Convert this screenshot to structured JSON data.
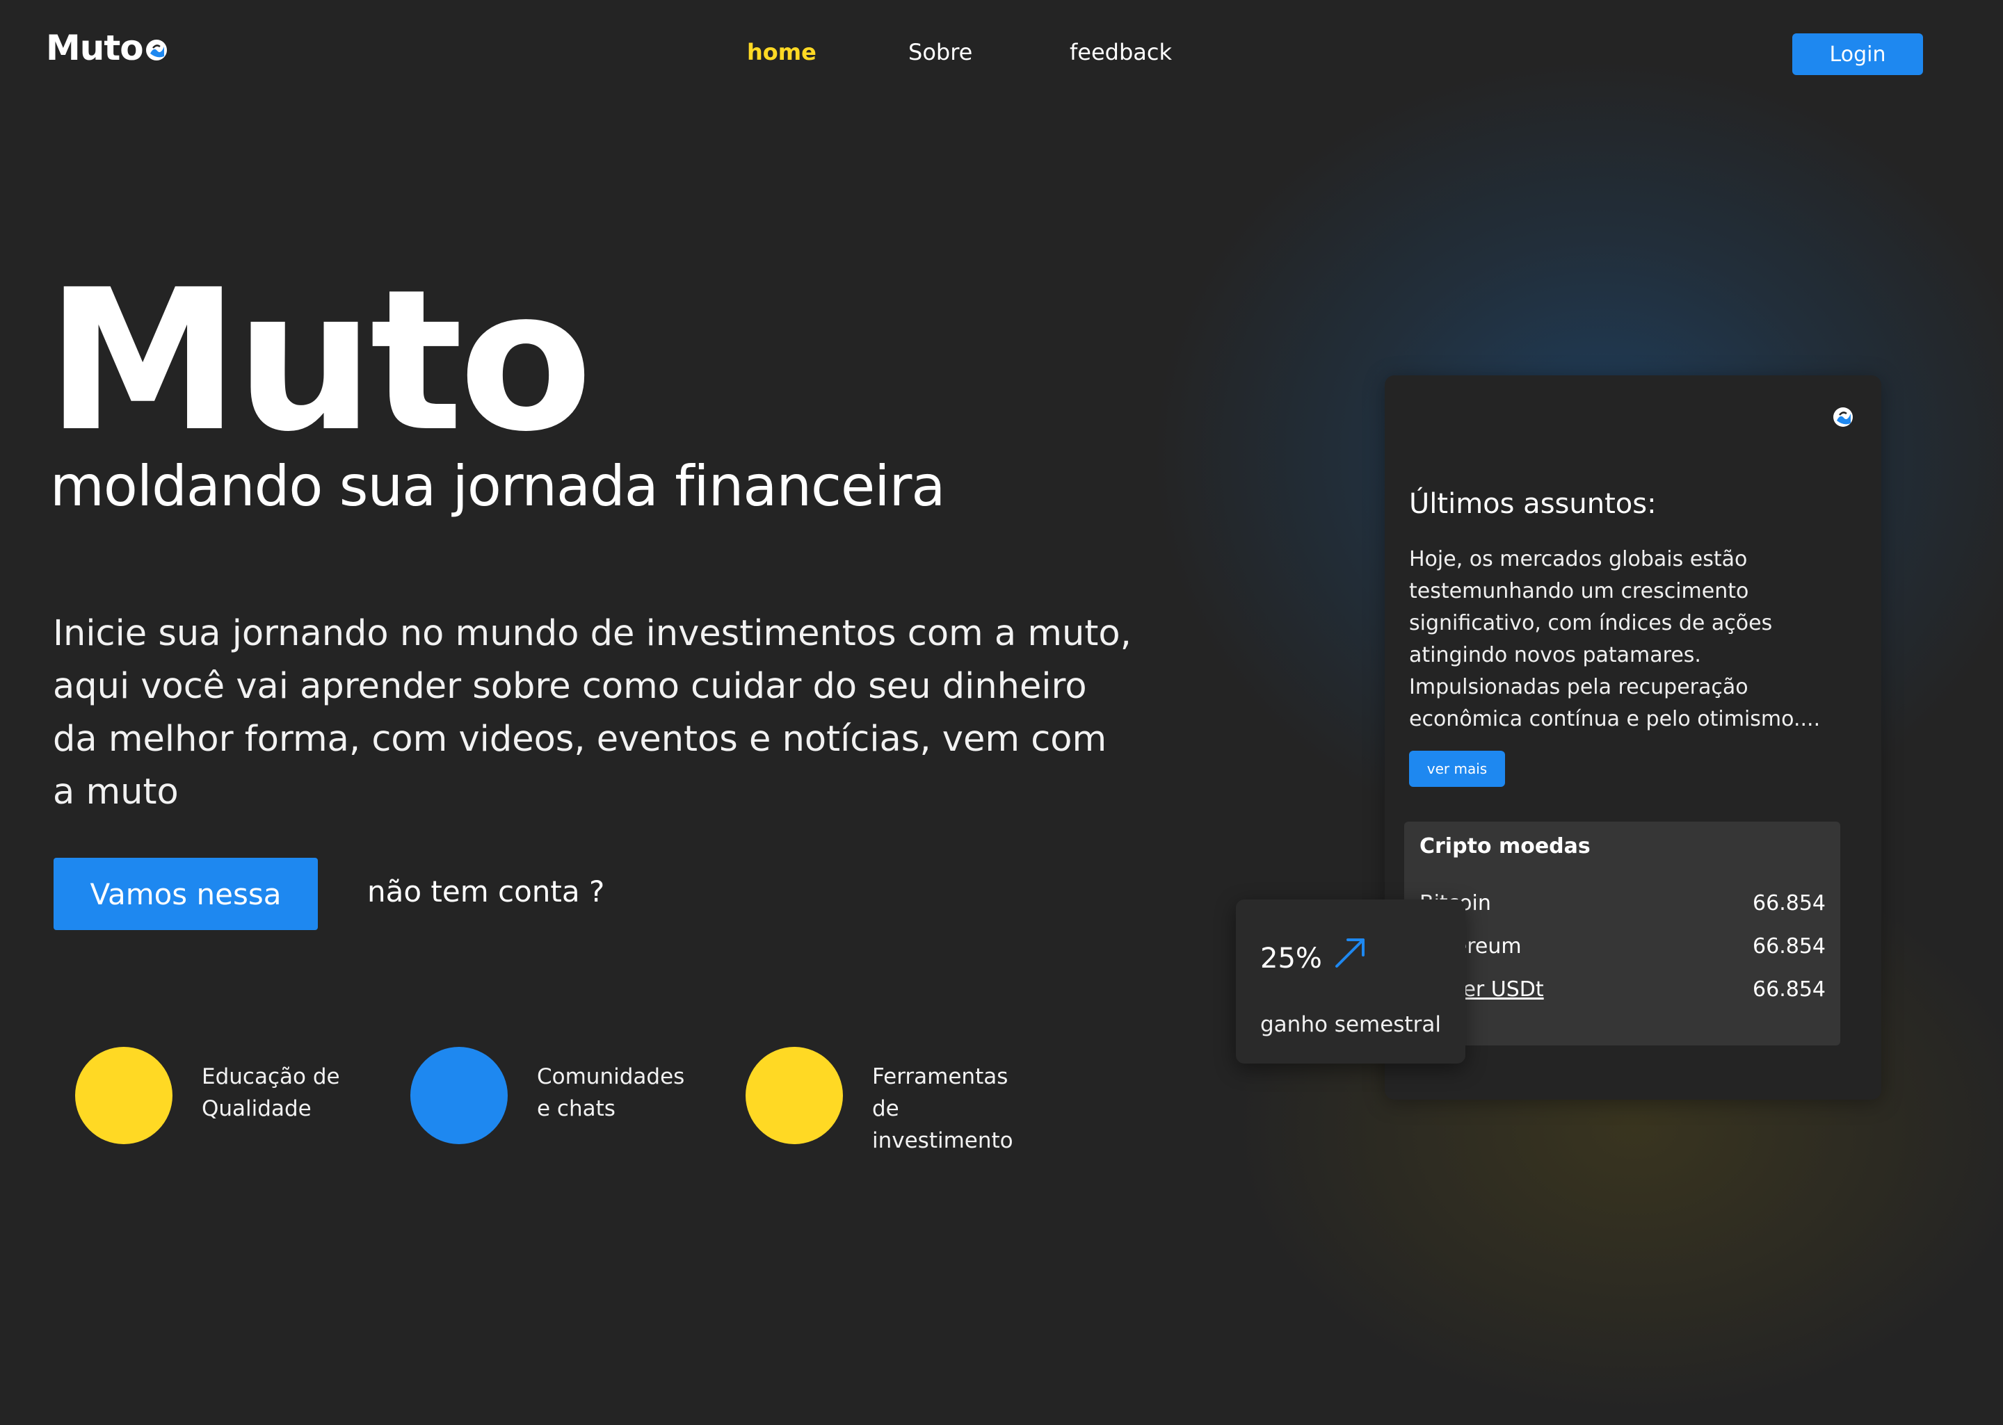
{
  "brand": {
    "name": "Muto"
  },
  "nav": {
    "home": "home",
    "sobre": "Sobre",
    "feedback": "feedback"
  },
  "header": {
    "login_label": "Login"
  },
  "hero": {
    "title": "Muto",
    "subtitle": "moldando sua jornada financeira",
    "description": "Inicie sua jornando no mundo de investimentos com a muto, aqui você vai aprender sobre como cuidar do seu dinheiro da melhor forma, com videos, eventos e notícias, vem com a muto",
    "cta_label": "Vamos nessa",
    "no_account": "não tem conta ?"
  },
  "features": [
    {
      "label": "Educação de Qualidade",
      "color": "#FFD924"
    },
    {
      "label": "Comunidades e chats",
      "color": "#1E88F0"
    },
    {
      "label": "Ferramentas de investimento",
      "color": "#FFD924"
    }
  ],
  "news_card": {
    "title": "Últimos assuntos:",
    "text": "Hoje, os mercados globais estão testemunhando um crescimento significativo, com índices de ações atingindo novos patamares. Impulsionadas pela recuperação econômica contínua e pelo otimismo....",
    "button_label": "ver mais"
  },
  "crypto": {
    "title": "Cripto moedas",
    "rows": [
      {
        "name": "Bitcoin",
        "value": "66.854"
      },
      {
        "name": "Ethereum",
        "value": "66.854"
      },
      {
        "name": "Tether USDt",
        "value": "66.854"
      }
    ]
  },
  "gain": {
    "value": "25%",
    "label": "ganho semestral",
    "icon": "arrow-up-right-icon"
  },
  "colors": {
    "accent_blue": "#1E88F0",
    "accent_yellow": "#FFD924",
    "background": "#242424"
  }
}
